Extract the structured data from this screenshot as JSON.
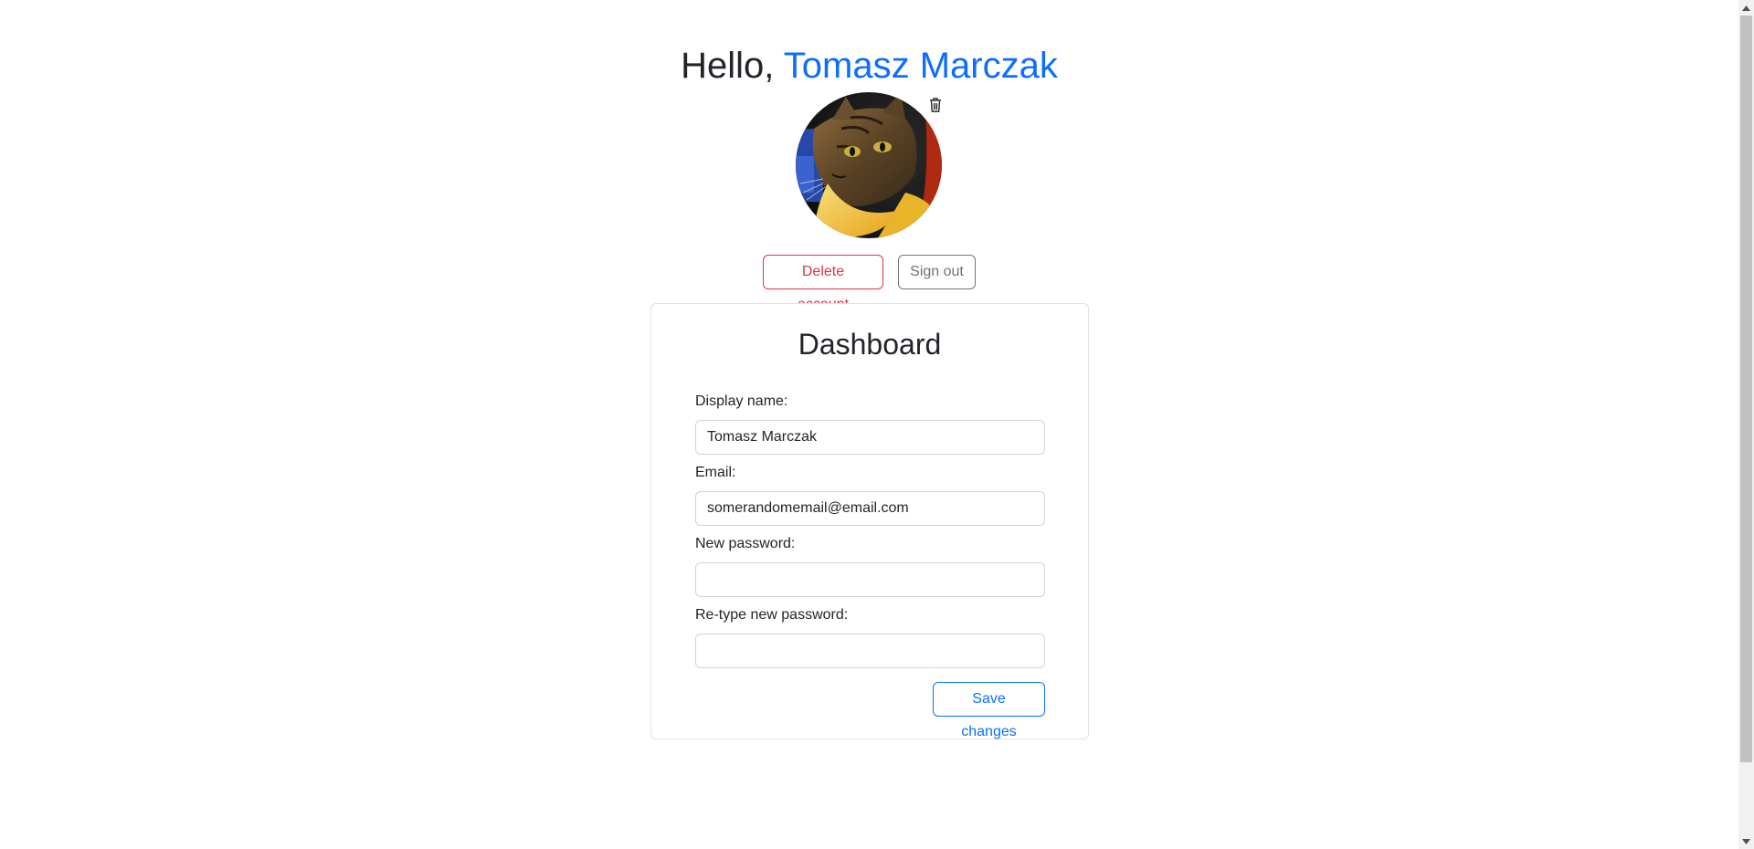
{
  "header": {
    "greeting_prefix": "Hello, ",
    "user_name": "Tomasz Marczak"
  },
  "avatar": {
    "delete_icon": "trash-icon"
  },
  "actions": {
    "delete_account_label": "Delete account",
    "sign_out_label": "Sign out"
  },
  "dashboard": {
    "title": "Dashboard",
    "display_name_label": "Display name:",
    "display_name_value": "Tomasz Marczak",
    "email_label": "Email:",
    "email_value": "somerandomemail@email.com",
    "new_password_label": "New password:",
    "new_password_value": "",
    "retype_password_label": "Re-type new password:",
    "retype_password_value": "",
    "save_label": "Save changes"
  },
  "colors": {
    "primary": "#0d6efd",
    "danger": "#dc3545",
    "secondary": "#6c757d",
    "text": "#212529",
    "border": "#dee2e6"
  }
}
